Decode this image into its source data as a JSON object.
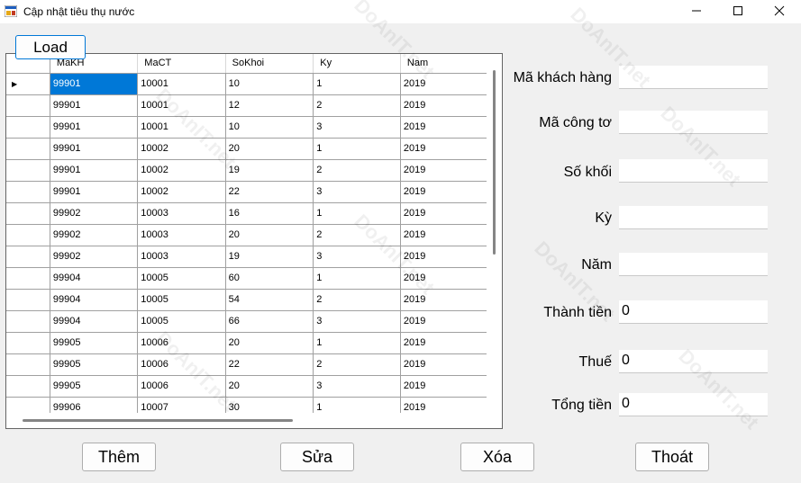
{
  "window": {
    "title": "Cập nhật tiêu thụ nước"
  },
  "toolbar": {
    "load_label": "Load"
  },
  "grid": {
    "columns": [
      "MaKH",
      "MaCT",
      "SoKhoi",
      "Ky",
      "Nam"
    ],
    "rows": [
      [
        "99901",
        "10001",
        "10",
        "1",
        "2019"
      ],
      [
        "99901",
        "10001",
        "12",
        "2",
        "2019"
      ],
      [
        "99901",
        "10001",
        "10",
        "3",
        "2019"
      ],
      [
        "99901",
        "10002",
        "20",
        "1",
        "2019"
      ],
      [
        "99901",
        "10002",
        "19",
        "2",
        "2019"
      ],
      [
        "99901",
        "10002",
        "22",
        "3",
        "2019"
      ],
      [
        "99902",
        "10003",
        "16",
        "1",
        "2019"
      ],
      [
        "99902",
        "10003",
        "20",
        "2",
        "2019"
      ],
      [
        "99902",
        "10003",
        "19",
        "3",
        "2019"
      ],
      [
        "99904",
        "10005",
        "60",
        "1",
        "2019"
      ],
      [
        "99904",
        "10005",
        "54",
        "2",
        "2019"
      ],
      [
        "99904",
        "10005",
        "66",
        "3",
        "2019"
      ],
      [
        "99905",
        "10006",
        "20",
        "1",
        "2019"
      ],
      [
        "99905",
        "10006",
        "22",
        "2",
        "2019"
      ],
      [
        "99905",
        "10006",
        "20",
        "3",
        "2019"
      ],
      [
        "99906",
        "10007",
        "30",
        "1",
        "2019"
      ]
    ]
  },
  "form": {
    "ma_khach_hang": {
      "label": "Mã khách hàng",
      "value": ""
    },
    "ma_cong_to": {
      "label": "Mã công tơ",
      "value": ""
    },
    "so_khoi": {
      "label": "Số khối",
      "value": ""
    },
    "ky": {
      "label": "Kỳ",
      "value": ""
    },
    "nam": {
      "label": "Năm",
      "value": ""
    },
    "thanh_tien": {
      "label": "Thành tiền",
      "value": "0"
    },
    "thue": {
      "label": "Thuế",
      "value": "0"
    },
    "tong_tien": {
      "label": "Tổng tiền",
      "value": "0"
    }
  },
  "buttons": {
    "them": "Thêm",
    "sua": "Sửa",
    "xoa": "Xóa",
    "thoat": "Thoát"
  },
  "watermark_text": "DoAnIT.net",
  "colors": {
    "selection": "#0078d7",
    "focus_border": "#0078d7",
    "background": "#f0f0f0"
  }
}
